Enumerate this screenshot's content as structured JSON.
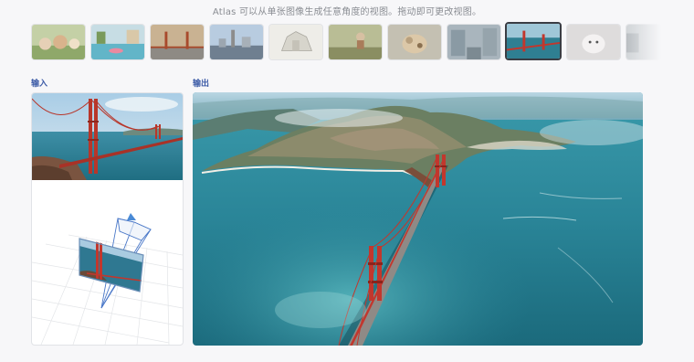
{
  "header": {
    "caption": "Atlas 可以从单张图像生成任意角度的视图。拖动即可更改视图。"
  },
  "gallery": {
    "selected_index": 8,
    "thumbnails": [
      {
        "icon": "plush-toys-thumb",
        "color": "#b9c79a"
      },
      {
        "icon": "pool-scene-thumb",
        "color": "#86c1cf"
      },
      {
        "icon": "golden-gate-sunset-thumb",
        "color": "#b08f6d"
      },
      {
        "icon": "city-skyline-thumb",
        "color": "#8fa6c4"
      },
      {
        "icon": "castle-sketch-thumb",
        "color": "#e8e6df"
      },
      {
        "icon": "garden-figure-thumb",
        "color": "#a3a37a"
      },
      {
        "icon": "plush-dog-thumb",
        "color": "#c9b7a0"
      },
      {
        "icon": "street-scene-thumb",
        "color": "#9aa8b0"
      },
      {
        "icon": "golden-gate-aerial-thumb",
        "color": "#2f6f86"
      },
      {
        "icon": "white-dog-thumb",
        "color": "#d8d6d6"
      },
      {
        "icon": "partial-thumb",
        "color": "#c8ccd0"
      }
    ]
  },
  "input": {
    "label": "输入"
  },
  "output": {
    "label": "输出"
  },
  "colors": {
    "accent_label": "#3b5aa6",
    "bridge": "#c2372d",
    "ocean": "#2e8a9a"
  }
}
